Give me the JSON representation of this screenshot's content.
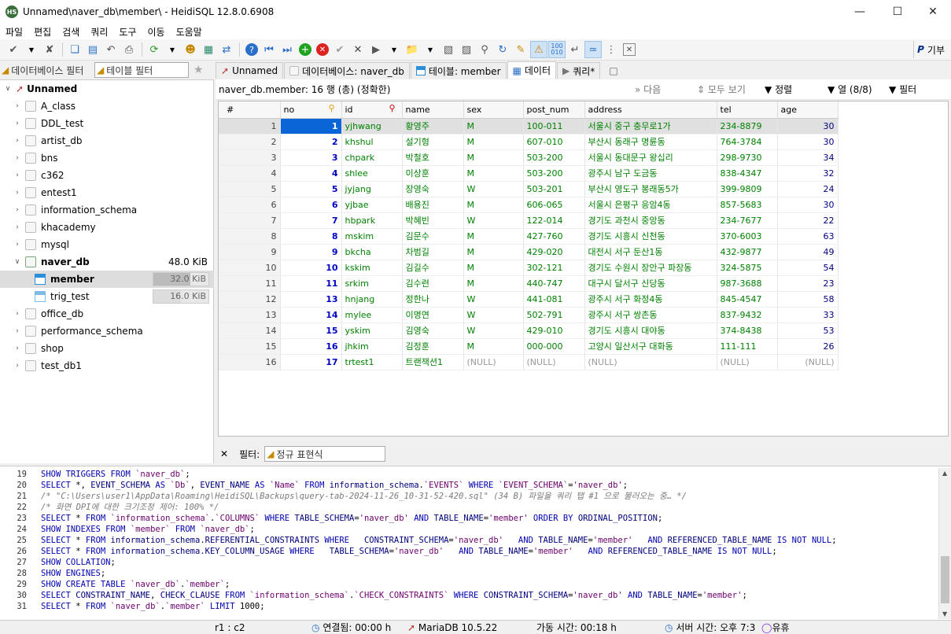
{
  "window": {
    "title": "Unnamed\\naver_db\\member\\ - HeidiSQL 12.8.0.6908",
    "icon": "HS"
  },
  "menu": [
    "파일",
    "편집",
    "검색",
    "쿼리",
    "도구",
    "이동",
    "도움말"
  ],
  "toolbar": {
    "donate_label": "기부"
  },
  "left": {
    "db_filter_placeholder": "데이터베이스 필터",
    "table_filter_placeholder": "테이블 필터"
  },
  "tree": {
    "root": "Unnamed",
    "databases": [
      "A_class",
      "DDL_test",
      "artist_db",
      "bns",
      "c362",
      "entest1",
      "information_schema",
      "khacademy",
      "mysql"
    ],
    "naver_db": {
      "name": "naver_db",
      "size": "48.0 KiB",
      "tables": [
        {
          "name": "member",
          "size": "32.0 KiB",
          "fill": 0.67
        },
        {
          "name": "trig_test",
          "size": "16.0 KiB",
          "fill": 0.5
        }
      ]
    },
    "databases_after": [
      "office_db",
      "performance_schema",
      "shop",
      "test_db1"
    ]
  },
  "tabs": [
    "Unnamed",
    "데이터베이스: naver_db",
    "테이블: member",
    "데이터",
    "쿼리*"
  ],
  "data_header": {
    "info": "naver_db.member: 16 행 (총) (정확한)",
    "next": "다음",
    "show_all": "모두 보기",
    "sort": "정렬",
    "columns": "열 (8/8)",
    "filter": "필터"
  },
  "grid": {
    "columns": [
      "#",
      "no",
      "id",
      "name",
      "sex",
      "post_num",
      "address",
      "tel",
      "age"
    ],
    "rows": [
      [
        "1",
        "1",
        "yjhwang",
        "황영주",
        "M",
        "100-011",
        "서울시 중구 충무로1가",
        "234-8879",
        "30"
      ],
      [
        "2",
        "2",
        "khshul",
        "설기형",
        "M",
        "607-010",
        "부산시 동래구 명륜동",
        "764-3784",
        "30"
      ],
      [
        "3",
        "3",
        "chpark",
        "박철호",
        "M",
        "503-200",
        "서울시 동대문구 왕십리",
        "298-9730",
        "34"
      ],
      [
        "4",
        "4",
        "shlee",
        "이상훈",
        "M",
        "503-200",
        "광주시 남구 도금동",
        "838-4347",
        "32"
      ],
      [
        "5",
        "5",
        "jyjang",
        "장영숙",
        "W",
        "503-201",
        "부산시 영도구 봉래동5가",
        "399-9809",
        "24"
      ],
      [
        "6",
        "6",
        "yjbae",
        "배용진",
        "M",
        "606-065",
        "서울시 은평구 응암4동",
        "857-5683",
        "30"
      ],
      [
        "7",
        "7",
        "hbpark",
        "박혜빈",
        "W",
        "122-014",
        "경기도 과천시 중앙동",
        "234-7677",
        "22"
      ],
      [
        "8",
        "8",
        "mskim",
        "김문수",
        "M",
        "427-760",
        "경기도 시흥시 신천동",
        "370-6003",
        "63"
      ],
      [
        "9",
        "9",
        "bkcha",
        "차범길",
        "M",
        "429-020",
        "대전시 서구 둔산1동",
        "432-9877",
        "49"
      ],
      [
        "10",
        "10",
        "kskim",
        "김길수",
        "M",
        "302-121",
        "경기도 수원시 장안구 파장동",
        "324-5875",
        "54"
      ],
      [
        "11",
        "11",
        "srkim",
        "김수련",
        "M",
        "440-747",
        "대구시 달서구 신당동",
        "987-3688",
        "23"
      ],
      [
        "12",
        "13",
        "hnjang",
        "정한나",
        "W",
        "441-081",
        "광주시 서구 화정4동",
        "845-4547",
        "58"
      ],
      [
        "13",
        "14",
        "mylee",
        "이명연",
        "W",
        "502-791",
        "광주시 서구 쌍촌동",
        "837-9432",
        "33"
      ],
      [
        "14",
        "15",
        "yskim",
        "김영숙",
        "W",
        "429-010",
        "경기도 시흥시 대야동",
        "374-8438",
        "53"
      ],
      [
        "15",
        "16",
        "jhkim",
        "김정훈",
        "M",
        "000-000",
        "고양시 일산서구 대화동",
        "111-111",
        "26"
      ],
      [
        "16",
        "17",
        "trtest1",
        "트랜잭션1",
        "(NULL)",
        "(NULL)",
        "(NULL)",
        "(NULL)",
        "(NULL)"
      ]
    ]
  },
  "filterbar": {
    "label": "필터:",
    "placeholder": "정규 표현식",
    "close": "✕"
  },
  "sql": [
    {
      "n": "19",
      "parts": [
        [
          "kw",
          "SHOW TRIGGERS FROM "
        ],
        [
          "str",
          "`naver_db`"
        ],
        [
          "t",
          ";"
        ]
      ]
    },
    {
      "n": "20",
      "parts": [
        [
          "kw",
          "SELECT "
        ],
        [
          "t",
          "*, "
        ],
        [
          "id",
          "EVENT_SCHEMA "
        ],
        [
          "kw",
          "AS "
        ],
        [
          "str",
          "`Db`"
        ],
        [
          "t",
          ", "
        ],
        [
          "id",
          "EVENT_NAME "
        ],
        [
          "kw",
          "AS "
        ],
        [
          "str",
          "`Name`"
        ],
        [
          "kw",
          " FROM "
        ],
        [
          "id",
          "information_schema"
        ],
        [
          "t",
          "."
        ],
        [
          "str",
          "`EVENTS`"
        ],
        [
          "kw",
          " WHERE "
        ],
        [
          "str",
          "`EVENT_SCHEMA`"
        ],
        [
          "t",
          "="
        ],
        [
          "str",
          "'naver_db'"
        ],
        [
          "t",
          ";"
        ]
      ]
    },
    {
      "n": "21",
      "parts": [
        [
          "cm",
          "/* \"C:\\Users\\user1\\AppData\\Roaming\\HeidiSQL\\Backups\\query-tab-2024-11-26_10-31-52-420.sql\" (34 B) 파일을 쿼리 탭 #1 으로 불러오는 중… */"
        ]
      ]
    },
    {
      "n": "22",
      "parts": [
        [
          "cm",
          "/* 화면 DPI에 대한 크기조정 제어: 100% */"
        ]
      ]
    },
    {
      "n": "23",
      "parts": [
        [
          "kw",
          "SELECT "
        ],
        [
          "t",
          "* "
        ],
        [
          "kw",
          "FROM "
        ],
        [
          "str",
          "`information_schema`"
        ],
        [
          "t",
          "."
        ],
        [
          "str",
          "`COLUMNS`"
        ],
        [
          "kw",
          " WHERE "
        ],
        [
          "id",
          "TABLE_SCHEMA"
        ],
        [
          "t",
          "="
        ],
        [
          "str",
          "'naver_db'"
        ],
        [
          "kw",
          " AND "
        ],
        [
          "id",
          "TABLE_NAME"
        ],
        [
          "t",
          "="
        ],
        [
          "str",
          "'member'"
        ],
        [
          "kw",
          " ORDER BY "
        ],
        [
          "id",
          "ORDINAL_POSITION"
        ],
        [
          "t",
          ";"
        ]
      ]
    },
    {
      "n": "24",
      "parts": [
        [
          "kw",
          "SHOW INDEXES FROM "
        ],
        [
          "str",
          "`member`"
        ],
        [
          "kw",
          " FROM "
        ],
        [
          "str",
          "`naver_db`"
        ],
        [
          "t",
          ";"
        ]
      ]
    },
    {
      "n": "25",
      "parts": [
        [
          "kw",
          "SELECT "
        ],
        [
          "t",
          "* "
        ],
        [
          "kw",
          "FROM "
        ],
        [
          "id",
          "information_schema.REFERENTIAL_CONSTRAINTS"
        ],
        [
          "kw",
          " WHERE   "
        ],
        [
          "id",
          "CONSTRAINT_SCHEMA"
        ],
        [
          "t",
          "="
        ],
        [
          "str",
          "'naver_db'"
        ],
        [
          "kw",
          "   AND "
        ],
        [
          "id",
          "TABLE_NAME"
        ],
        [
          "t",
          "="
        ],
        [
          "str",
          "'member'"
        ],
        [
          "kw",
          "   AND "
        ],
        [
          "id",
          "REFERENCED_TABLE_NAME "
        ],
        [
          "kw",
          "IS NOT NULL"
        ],
        [
          "t",
          ";"
        ]
      ]
    },
    {
      "n": "26",
      "parts": [
        [
          "kw",
          "SELECT "
        ],
        [
          "t",
          "* "
        ],
        [
          "kw",
          "FROM "
        ],
        [
          "id",
          "information_schema.KEY_COLUMN_USAGE"
        ],
        [
          "kw",
          " WHERE   "
        ],
        [
          "id",
          "TABLE_SCHEMA"
        ],
        [
          "t",
          "="
        ],
        [
          "str",
          "'naver_db'"
        ],
        [
          "kw",
          "   AND "
        ],
        [
          "id",
          "TABLE_NAME"
        ],
        [
          "t",
          "="
        ],
        [
          "str",
          "'member'"
        ],
        [
          "kw",
          "   AND "
        ],
        [
          "id",
          "REFERENCED_TABLE_NAME "
        ],
        [
          "kw",
          "IS NOT NULL"
        ],
        [
          "t",
          ";"
        ]
      ]
    },
    {
      "n": "27",
      "parts": [
        [
          "kw",
          "SHOW COLLATION"
        ],
        [
          "t",
          ";"
        ]
      ]
    },
    {
      "n": "28",
      "parts": [
        [
          "kw",
          "SHOW ENGINES"
        ],
        [
          "t",
          ";"
        ]
      ]
    },
    {
      "n": "29",
      "parts": [
        [
          "kw",
          "SHOW CREATE TABLE "
        ],
        [
          "str",
          "`naver_db`"
        ],
        [
          "t",
          "."
        ],
        [
          "str",
          "`member`"
        ],
        [
          "t",
          ";"
        ]
      ]
    },
    {
      "n": "30",
      "parts": [
        [
          "kw",
          "SELECT "
        ],
        [
          "id",
          "CONSTRAINT_NAME"
        ],
        [
          "t",
          ", "
        ],
        [
          "id",
          "CHECK_CLAUSE"
        ],
        [
          "kw",
          " FROM "
        ],
        [
          "str",
          "`information_schema`"
        ],
        [
          "t",
          "."
        ],
        [
          "str",
          "`CHECK_CONSTRAINTS`"
        ],
        [
          "kw",
          " WHERE "
        ],
        [
          "id",
          "CONSTRAINT_SCHEMA"
        ],
        [
          "t",
          "="
        ],
        [
          "str",
          "'naver_db'"
        ],
        [
          "kw",
          " AND "
        ],
        [
          "id",
          "TABLE_NAME"
        ],
        [
          "t",
          "="
        ],
        [
          "str",
          "'member'"
        ],
        [
          "t",
          ";"
        ]
      ]
    },
    {
      "n": "31",
      "parts": [
        [
          "kw",
          "SELECT "
        ],
        [
          "t",
          "* "
        ],
        [
          "kw",
          "FROM "
        ],
        [
          "str",
          "`naver_db`"
        ],
        [
          "t",
          "."
        ],
        [
          "str",
          "`member`"
        ],
        [
          "kw",
          " LIMIT "
        ],
        [
          "t",
          "1000;"
        ]
      ]
    }
  ],
  "status": {
    "pos": "r1 : c2",
    "connected": "연결됨: 00:00 h",
    "server": "MariaDB 10.5.22",
    "uptime": "가동 시간: 00:18 h",
    "server_time": "서버 시간: 오후 7:3",
    "idle": "유휴"
  }
}
